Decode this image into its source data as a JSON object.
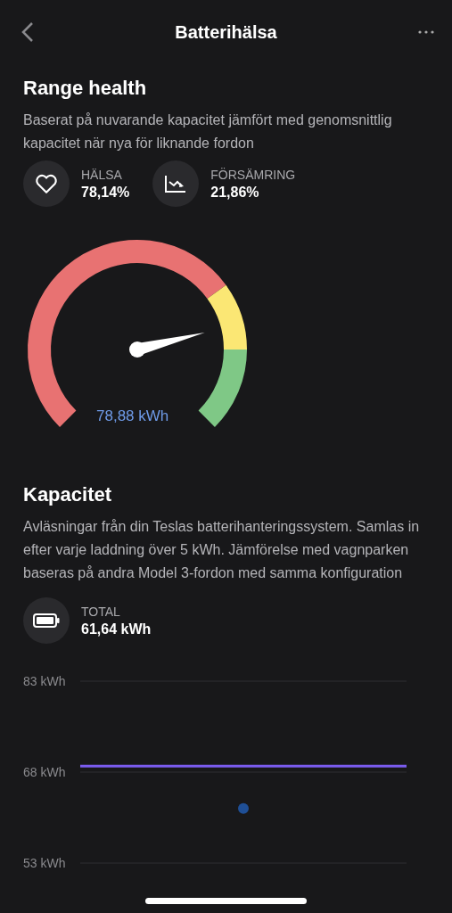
{
  "header": {
    "title": "Batterihälsa"
  },
  "range_health": {
    "title": "Range health",
    "description": "Baserat på nuvarande kapacitet jämfört med genomsnittlig kapacitet när nya för liknande fordon",
    "stats": [
      {
        "kind": "heart",
        "label": "HÄLSA",
        "value": "78,14%"
      },
      {
        "kind": "trend",
        "label": "FÖRSÄMRING",
        "value": "21,86%"
      }
    ],
    "gauge": {
      "reading": "78,88 kWh",
      "segments": [
        {
          "color": "#e87272"
        },
        {
          "color": "#fbe774"
        },
        {
          "color": "#7fc886"
        }
      ]
    }
  },
  "capacity": {
    "title": "Kapacitet",
    "description": "Avläsningar från din Teslas batterihanteringssystem. Samlas in efter varje laddning över 5 kWh. Jämförelse med vagnparken baseras på andra Model 3-fordon med samma konfiguration",
    "stats": [
      {
        "kind": "battery",
        "label": "TOTAL",
        "value": "61,64 kWh"
      }
    ],
    "chart_data": {
      "type": "line",
      "series": [
        {
          "color": "#7b5cf0",
          "values": [
            69,
            69,
            69
          ]
        },
        {
          "color": "#1f4f96",
          "marker": true,
          "values": [
            null,
            62,
            null
          ]
        }
      ],
      "ylim": [
        53,
        83
      ],
      "yticks": [
        {
          "value": 53,
          "label": "53 kWh"
        },
        {
          "value": 68,
          "label": "68 kWh"
        },
        {
          "value": 83,
          "label": "83 kWh"
        }
      ]
    }
  }
}
